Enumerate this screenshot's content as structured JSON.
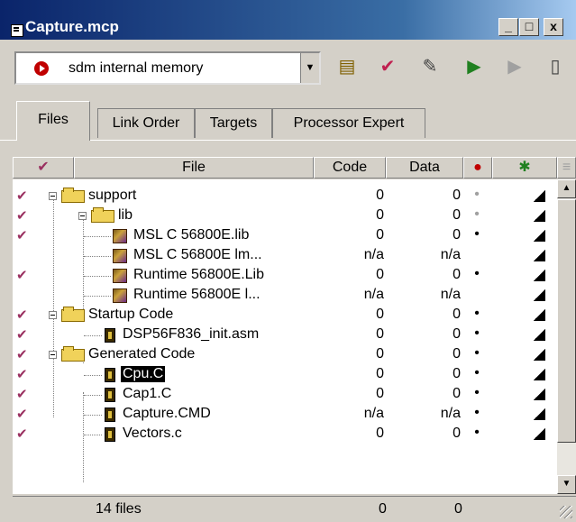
{
  "window": {
    "title": "Capture.mcp",
    "controls": [
      "_",
      "□",
      "x"
    ]
  },
  "toolbar": {
    "target": "sdm internal memory",
    "tools": [
      "settings-icon",
      "check-icon",
      "make-icon",
      "debug-icon",
      "run-icon",
      "remote-icon"
    ]
  },
  "tabs": [
    "Files",
    "Link Order",
    "Targets",
    "Processor Expert"
  ],
  "columns": {
    "file": "File",
    "code": "Code",
    "data": "Data"
  },
  "rows": [
    {
      "name": "support",
      "code": "0",
      "data": "0",
      "kind": "folder"
    },
    {
      "name": "lib",
      "code": "0",
      "data": "0",
      "kind": "folder"
    },
    {
      "name": "MSL C 56800E.lib",
      "code": "0",
      "data": "0",
      "kind": "lib"
    },
    {
      "name": "MSL C 56800E lm...",
      "code": "n/a",
      "data": "n/a",
      "kind": "lib"
    },
    {
      "name": "Runtime 56800E.Lib",
      "code": "0",
      "data": "0",
      "kind": "lib"
    },
    {
      "name": "Runtime 56800E l...",
      "code": "n/a",
      "data": "n/a",
      "kind": "lib"
    },
    {
      "name": "Startup Code",
      "code": "0",
      "data": "0",
      "kind": "folder"
    },
    {
      "name": "DSP56F836_init.asm",
      "code": "0",
      "data": "0",
      "kind": "file"
    },
    {
      "name": "Generated Code",
      "code": "0",
      "data": "0",
      "kind": "folder"
    },
    {
      "name": "Cpu.C",
      "code": "0",
      "data": "0",
      "kind": "file"
    },
    {
      "name": "Cap1.C",
      "code": "0",
      "data": "0",
      "kind": "file"
    },
    {
      "name": "Capture.CMD",
      "code": "n/a",
      "data": "n/a",
      "kind": "file"
    },
    {
      "name": "Vectors.c",
      "code": "0",
      "data": "0",
      "kind": "file"
    }
  ],
  "status": {
    "files": "14 files",
    "code_total": "0",
    "data_total": "0"
  },
  "colors": {
    "titlebar_start": "#0a246a",
    "titlebar_end": "#a6caf0",
    "chrome": "#d4d0c8",
    "check": "#9a3060"
  }
}
